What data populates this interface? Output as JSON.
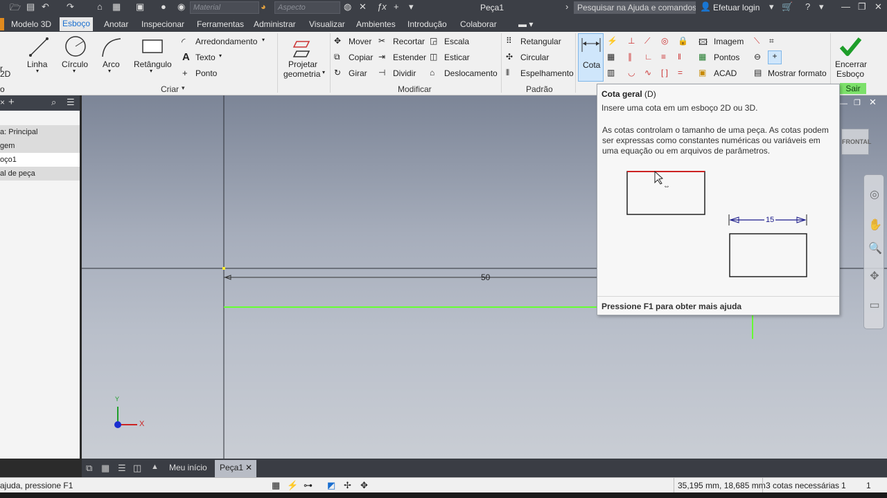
{
  "window": {
    "title": "Peça1",
    "search_placeholder": "Pesquisar na Ajuda e comandos...",
    "login": "Efetuar login",
    "material": "Material",
    "appearance": "Aspecto"
  },
  "menu": {
    "tabs": [
      "Modelo 3D",
      "Esboço",
      "Anotar",
      "Inspecionar",
      "Ferramentas",
      "Administrar",
      "Visualizar",
      "Ambientes",
      "Introdução",
      "Colaborar"
    ],
    "active": "Esboço"
  },
  "ribbon": {
    "left_cut": "r",
    "left_cut_2d": "2D",
    "left_cut_o": "o",
    "create": {
      "label": "Criar",
      "line": "Linha",
      "circle": "Círculo",
      "arc": "Arco",
      "rectangle": "Retângulo",
      "fillet": "Arredondamento",
      "text": "Texto",
      "point": "Ponto"
    },
    "project": "Projetar",
    "project2": "geometria",
    "modify": {
      "label": "Modificar",
      "move": "Mover",
      "copy": "Copiar",
      "rotate": "Girar",
      "trim": "Recortar",
      "extend": "Estender",
      "split": "Dividir",
      "scale": "Escala",
      "stretch": "Esticar",
      "offset": "Deslocamento"
    },
    "pattern": {
      "label": "Padrão",
      "rectangular": "Retangular",
      "circular": "Circular",
      "mirror": "Espelhamento"
    },
    "dimension": "Cota",
    "insert": {
      "image": "Imagem",
      "points": "Pontos",
      "acad": "ACAD"
    },
    "show_format": "Mostrar formato",
    "finish": "Encerrar",
    "finish2": "Esboço",
    "exit": "Sair"
  },
  "browser": {
    "items": [
      "a: Principal",
      "gem",
      "oço1",
      "al de peça"
    ]
  },
  "canvas": {
    "dimension_value": "50",
    "axis_x": "X",
    "axis_y": "Y",
    "viewcube_label": "FRONTAL"
  },
  "tooltip": {
    "title": "Cota geral",
    "shortcut": "(D)",
    "line1": "Insere uma cota em um esboço 2D ou 3D.",
    "line2": "As cotas controlam o tamanho de uma peça. As cotas podem ser expressas como constantes numéricas ou variáveis em uma equação ou em arquivos de parâmetros.",
    "example_value": "15",
    "footer": "Pressione F1 para obter mais ajuda"
  },
  "doctabs": {
    "home": "Meu início",
    "part": "Peça1"
  },
  "status": {
    "help": "ajuda, pressione F1",
    "coords": "35,195 mm, 18,685 mm",
    "constraints": "3 cotas necessárias",
    "n1": "1",
    "n2": "1"
  },
  "colors": {
    "accent": "#1a6fd0",
    "sketch_green": "#66ff33",
    "constraint_red": "#cc2222",
    "finish_green": "#1e9e2a"
  }
}
